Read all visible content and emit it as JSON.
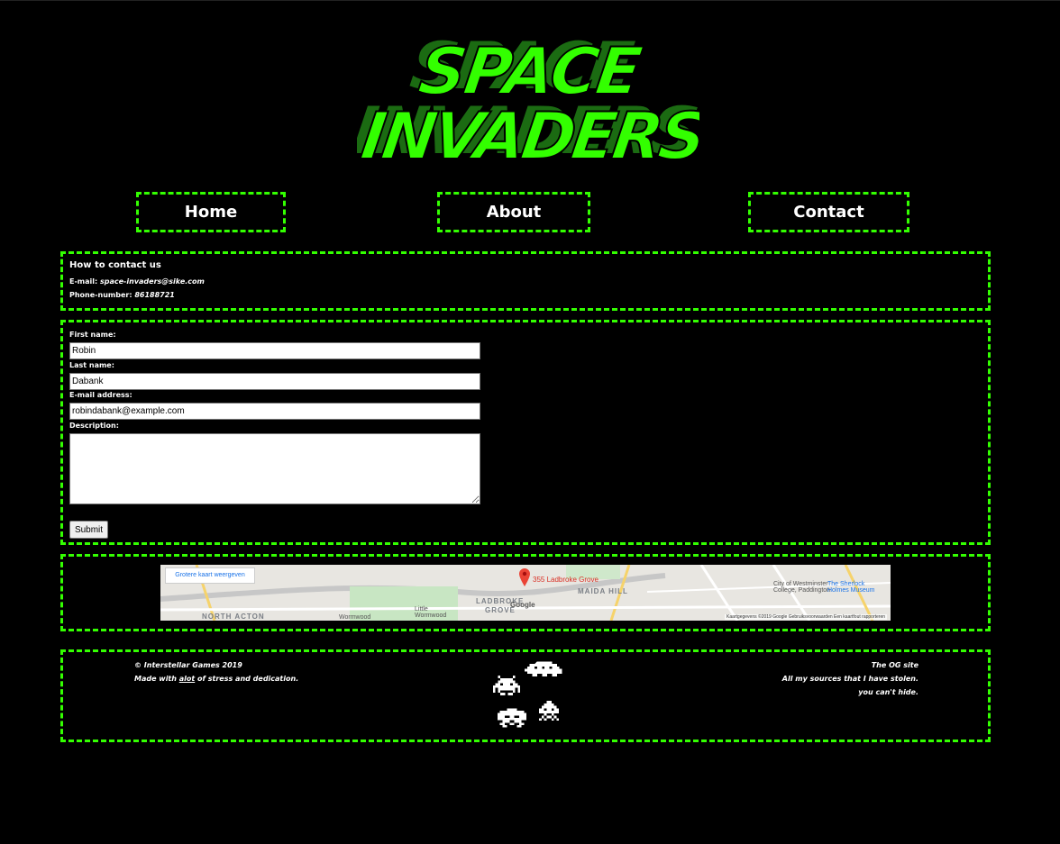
{
  "logo": {
    "line1": "SPACE",
    "line2": "INVADERS"
  },
  "nav": {
    "home": "Home",
    "about": "About",
    "contact": "Contact"
  },
  "contact_info": {
    "title": "How to contact us",
    "email_label": "E-mail:",
    "email_value": "space-invaders@sike.com",
    "phone_label": "Phone-number:",
    "phone_value": "86188721"
  },
  "form": {
    "first_name_label": "First name:",
    "first_name_value": "Robin",
    "last_name_label": "Last name:",
    "last_name_value": "Dabank",
    "email_label": "E-mail address:",
    "email_value": "robindabank@example.com",
    "description_label": "Description:",
    "description_value": "",
    "submit_label": "Submit"
  },
  "map": {
    "larger_map": "Grotere kaart weergeven",
    "pin_label": "355 Ladbroke Grove",
    "area1": "MAIDA HILL",
    "area2": "LADBROKE",
    "area3": "GROVE",
    "area4": "NORTH ACTON",
    "place1": "City of Westminster College, Paddington",
    "place2": "The Sherlock Holmes Museum",
    "street1": "Wormwood",
    "street2": "Little Wormwood",
    "google": "Google",
    "attribution": "Kaartgegevens ©2019 Google   Gebruiksvoorwaarden   Een kaartfout rapporteren"
  },
  "footer": {
    "copyright": "© Interstellar Games 2019",
    "made_with": "Made with",
    "alot": "alot",
    "of_stress": "of stress and",
    "dedication": "dedication.",
    "og_site": "The OG site",
    "sources": "All my sources that I have stolen.",
    "hide": "you can't hide."
  },
  "colors": {
    "accent": "#33ff00",
    "logo_shadow": "#1b6b12",
    "background": "#000000"
  }
}
